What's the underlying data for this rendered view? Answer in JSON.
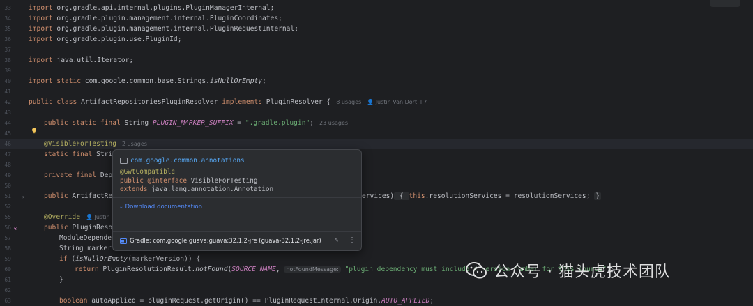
{
  "editor": {
    "lines": [
      {
        "num": "33",
        "tokens": [
          {
            "t": "import",
            "c": "kw"
          },
          {
            "t": " org.gradle.api.internal.plugins.PluginManagerInternal;"
          }
        ]
      },
      {
        "num": "34",
        "tokens": [
          {
            "t": "import",
            "c": "kw"
          },
          {
            "t": " org.gradle.plugin.management.internal.PluginCoordinates;"
          }
        ]
      },
      {
        "num": "35",
        "tokens": [
          {
            "t": "import",
            "c": "kw"
          },
          {
            "t": " org.gradle.plugin.management.internal.PluginRequestInternal;"
          }
        ]
      },
      {
        "num": "36",
        "tokens": [
          {
            "t": "import",
            "c": "kw"
          },
          {
            "t": " org.gradle.plugin.use.PluginId;"
          }
        ]
      },
      {
        "num": "37",
        "tokens": []
      },
      {
        "num": "38",
        "tokens": [
          {
            "t": "import",
            "c": "kw"
          },
          {
            "t": " java.util.Iterator;"
          }
        ]
      },
      {
        "num": "39",
        "tokens": []
      },
      {
        "num": "40",
        "tokens": [
          {
            "t": "import static",
            "c": "kw"
          },
          {
            "t": " com.google.common.base.Strings."
          },
          {
            "t": "isNullOrEmpty",
            "c": "stat"
          },
          {
            "t": ";"
          }
        ]
      },
      {
        "num": "41",
        "tokens": []
      },
      {
        "num": "42",
        "tokens": [
          {
            "t": "public class",
            "c": "kw"
          },
          {
            "t": " ArtifactRepositoriesPluginResolver "
          },
          {
            "t": "implements",
            "c": "kw"
          },
          {
            "t": " PluginResolver {"
          },
          {
            "t": "8 usages",
            "c": "hint"
          },
          {
            "t": "👤 Justin Van Dort +7",
            "c": "hint"
          }
        ]
      },
      {
        "num": "43",
        "tokens": []
      },
      {
        "num": "44",
        "indent": 1,
        "tokens": [
          {
            "t": "public static final",
            "c": "kw"
          },
          {
            "t": " String "
          },
          {
            "t": "PLUGIN_MARKER_SUFFIX",
            "c": "cnst"
          },
          {
            "t": " = "
          },
          {
            "t": "\".gradle.plugin\"",
            "c": "str"
          },
          {
            "t": ";"
          },
          {
            "t": "23 usages",
            "c": "hint"
          }
        ]
      },
      {
        "num": "45",
        "tokens": []
      },
      {
        "num": "46",
        "indent": 1,
        "current": true,
        "tokens": [
          {
            "t": "@VisibleForTesting",
            "c": "ann"
          },
          {
            "t": "2 usages",
            "c": "hint"
          }
        ]
      },
      {
        "num": "47",
        "indent": 1,
        "tokens": [
          {
            "t": "static final",
            "c": "kw"
          },
          {
            "t": " Strin"
          }
        ]
      },
      {
        "num": "48",
        "tokens": []
      },
      {
        "num": "49",
        "indent": 1,
        "tokens": [
          {
            "t": "private final",
            "c": "kw"
          },
          {
            "t": " Depe"
          }
        ]
      },
      {
        "num": "50",
        "tokens": []
      },
      {
        "num": "51",
        "indent": 1,
        "tokens": [
          {
            "t": "public",
            "c": "kw"
          },
          {
            "t": " ArtifactRep"
          }
        ]
      },
      {
        "num": "52",
        "tokens": []
      },
      {
        "num": "55",
        "indent": 1,
        "tokens": [
          {
            "t": "@Override",
            "c": "ann"
          },
          {
            "t": "👤 Justin V",
            "c": "hint"
          }
        ]
      },
      {
        "num": "56",
        "indent": 1,
        "tokens": [
          {
            "t": "public",
            "c": "kw"
          },
          {
            "t": " PluginResol"
          }
        ]
      },
      {
        "num": "57",
        "indent": 2,
        "tokens": [
          {
            "t": "ModuleDependen"
          }
        ]
      },
      {
        "num": "58",
        "indent": 2,
        "tokens": [
          {
            "t": "String markerVe"
          }
        ]
      },
      {
        "num": "59",
        "indent": 2,
        "tokens": [
          {
            "t": "if",
            "c": "kw"
          },
          {
            "t": " ("
          },
          {
            "t": "isNullOrEmpty",
            "c": "stat"
          },
          {
            "t": "(markerVersion)) {"
          }
        ]
      },
      {
        "num": "60",
        "indent": 3,
        "tokens": [
          {
            "t": "return",
            "c": "kw"
          },
          {
            "t": " PluginResolutionResult."
          },
          {
            "t": "notFound",
            "c": "stat"
          },
          {
            "t": "("
          },
          {
            "t": "SOURCE_NAME",
            "c": "cnst"
          },
          {
            "t": ", "
          },
          {
            "t": "notFoundMessage:",
            "c": "inlay"
          },
          {
            "t": " "
          },
          {
            "t": "\"plugin dependency must include a version number for this source\"",
            "c": "str"
          },
          {
            "t": ");"
          }
        ]
      },
      {
        "num": "61",
        "indent": 2,
        "tokens": [
          {
            "t": "}"
          }
        ]
      },
      {
        "num": "62",
        "tokens": []
      },
      {
        "num": "63",
        "indent": 2,
        "tokens": [
          {
            "t": "boolean",
            "c": "kw"
          },
          {
            "t": " autoApplied = pluginRequest.getOrigin() == PluginRequestInternal.Origin."
          },
          {
            "t": "AUTO_APPLIED",
            "c": "cnst"
          },
          {
            "t": ";"
          }
        ]
      }
    ],
    "line51_tail": [
      {
        "t": "ervices)"
      },
      {
        "t": " { ",
        "c": "fold"
      },
      {
        "t": "this",
        "c": "kw"
      },
      {
        "t": ".resolutionServices = resolutionServices; "
      },
      {
        "t": "}",
        "c": "fold"
      }
    ]
  },
  "popup": {
    "package": "com.google.common.annotations",
    "signature": [
      [
        {
          "t": "@GwtCompatible",
          "c": "a"
        }
      ],
      [
        {
          "t": "public",
          "c": "k"
        },
        {
          "t": " "
        },
        {
          "t": "@interface",
          "c": "k"
        },
        {
          "t": " VisibleForTesting"
        }
      ],
      [
        {
          "t": "extends",
          "c": "k"
        },
        {
          "t": " java.lang.annotation.Annotation"
        }
      ]
    ],
    "download_label": "Download documentation",
    "library": "Gradle: com.google.guava:guava:32.1.2-jre (guava-32.1.2-jre.jar)"
  },
  "watermark": {
    "text": "公众号 · 猫头虎技术团队"
  },
  "colors": {
    "background": "#1e1f22",
    "keyword": "#cf8e6d",
    "annotation": "#b3ae60",
    "string": "#6aab73",
    "constant": "#c77dbb",
    "link": "#548af7"
  }
}
